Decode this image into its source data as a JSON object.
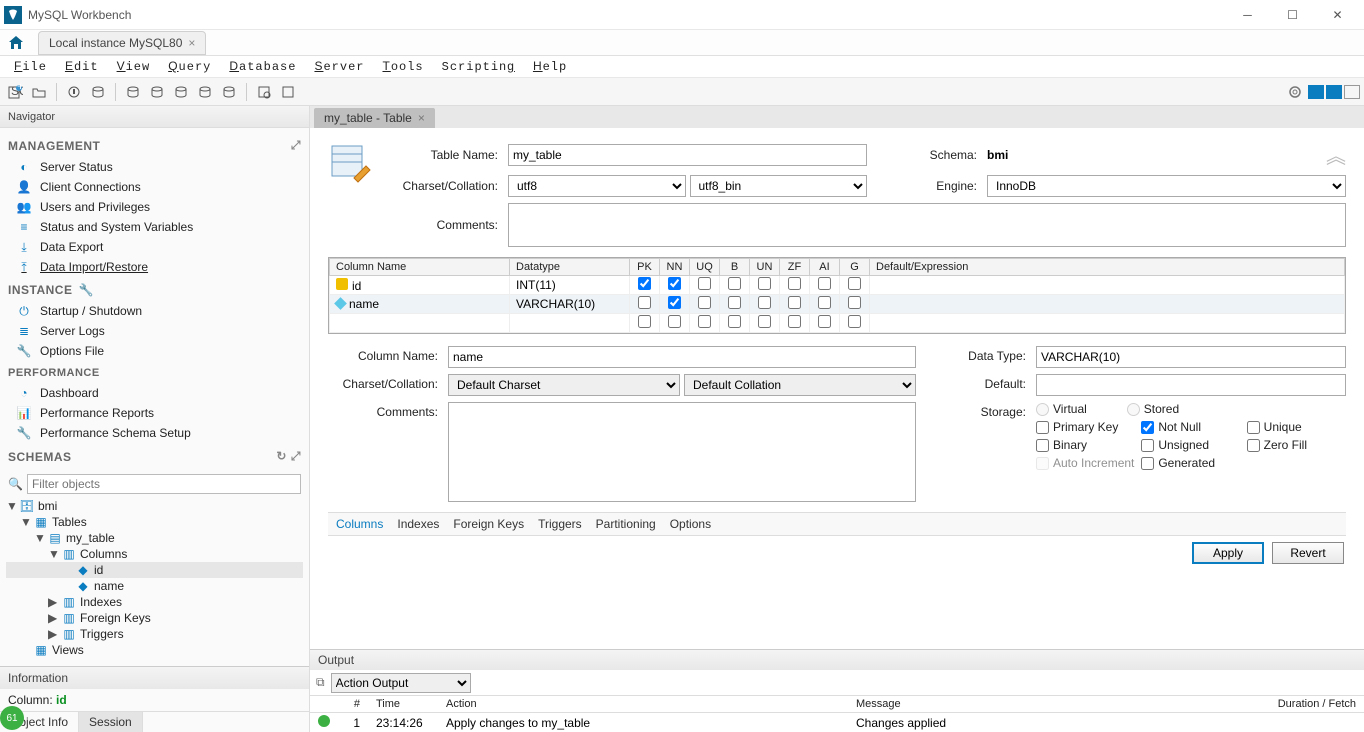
{
  "titlebar": {
    "app_name": "MySQL Workbench"
  },
  "conn_tab": {
    "label": "Local instance MySQL80"
  },
  "menus": [
    "File",
    "Edit",
    "View",
    "Query",
    "Database",
    "Server",
    "Tools",
    "Scripting",
    "Help"
  ],
  "navigator": {
    "title": "Navigator",
    "sections": {
      "management": {
        "title": "MANAGEMENT",
        "items": [
          "Server Status",
          "Client Connections",
          "Users and Privileges",
          "Status and System Variables",
          "Data Export",
          "Data Import/Restore"
        ]
      },
      "instance": {
        "title": "INSTANCE",
        "items": [
          "Startup / Shutdown",
          "Server Logs",
          "Options File"
        ]
      },
      "performance": {
        "title": "PERFORMANCE",
        "items": [
          "Dashboard",
          "Performance Reports",
          "Performance Schema Setup"
        ]
      },
      "schemas": {
        "title": "SCHEMAS",
        "filter_placeholder": "Filter objects"
      }
    },
    "tree": {
      "db": "bmi",
      "tables_label": "Tables",
      "table": "my_table",
      "columns_label": "Columns",
      "columns": [
        "id",
        "name"
      ],
      "indexes_label": "Indexes",
      "fks_label": "Foreign Keys",
      "triggers_label": "Triggers",
      "views_label": "Views"
    },
    "info": {
      "title": "Information",
      "label": "Column:",
      "value": "id",
      "tabs": [
        "Object Info",
        "Session"
      ],
      "active_tab": "Session"
    }
  },
  "editor": {
    "tab_title": "my_table - Table",
    "labels": {
      "table_name": "Table Name:",
      "charset": "Charset/Collation:",
      "comments": "Comments:",
      "schema": "Schema:",
      "engine": "Engine:"
    },
    "values": {
      "table_name": "my_table",
      "charset": "utf8",
      "collation": "utf8_bin",
      "schema": "bmi",
      "engine": "InnoDB",
      "comments": ""
    },
    "grid": {
      "headers": [
        "Column Name",
        "Datatype",
        "PK",
        "NN",
        "UQ",
        "B",
        "UN",
        "ZF",
        "AI",
        "G",
        "Default/Expression"
      ],
      "rows": [
        {
          "name": "id",
          "datatype": "INT(11)",
          "pk": true,
          "nn": true,
          "uq": false,
          "b": false,
          "un": false,
          "zf": false,
          "ai": false,
          "g": false,
          "default": ""
        },
        {
          "name": "name",
          "datatype": "VARCHAR(10)",
          "pk": false,
          "nn": true,
          "uq": false,
          "b": false,
          "un": false,
          "zf": false,
          "ai": false,
          "g": false,
          "default": ""
        }
      ]
    },
    "col_detail": {
      "labels": {
        "column_name": "Column Name:",
        "charset": "Charset/Collation:",
        "comments": "Comments:",
        "data_type": "Data Type:",
        "default": "Default:",
        "storage": "Storage:"
      },
      "values": {
        "column_name": "name",
        "charset": "Default Charset",
        "collation": "Default Collation",
        "data_type": "VARCHAR(10)",
        "default": "",
        "comments": ""
      },
      "storage": {
        "virtual": "Virtual",
        "stored": "Stored",
        "primary_key": "Primary Key",
        "not_null": "Not Null",
        "unique": "Unique",
        "binary": "Binary",
        "unsigned": "Unsigned",
        "zero_fill": "Zero Fill",
        "auto_increment": "Auto Increment",
        "generated": "Generated",
        "checked": {
          "not_null": true
        }
      }
    },
    "bottom_tabs": [
      "Columns",
      "Indexes",
      "Foreign Keys",
      "Triggers",
      "Partitioning",
      "Options"
    ],
    "buttons": {
      "apply": "Apply",
      "revert": "Revert"
    }
  },
  "output": {
    "title": "Output",
    "dropdown": "Action Output",
    "headers": [
      "",
      "#",
      "Time",
      "Action",
      "Message",
      "Duration / Fetch"
    ],
    "rows": [
      {
        "status": "ok",
        "num": "1",
        "time": "23:14:26",
        "action": "Apply changes to my_table",
        "message": "Changes applied",
        "duration": ""
      }
    ]
  },
  "badge": "61"
}
